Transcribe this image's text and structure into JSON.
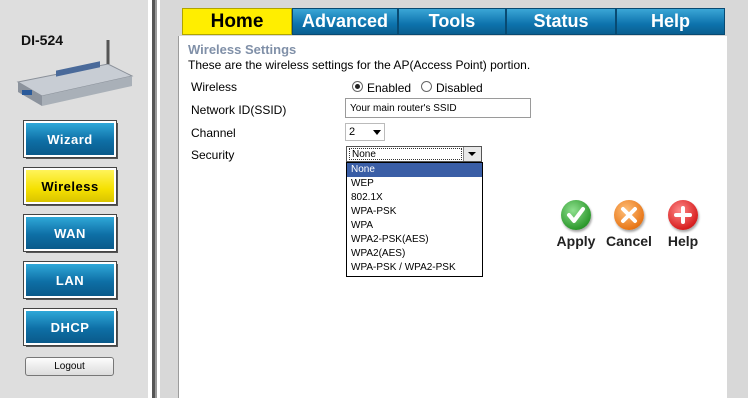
{
  "sidebar": {
    "model": "DI-524",
    "nav": [
      "Wizard",
      "Wireless",
      "WAN",
      "LAN",
      "DHCP"
    ],
    "active_nav": "Wireless",
    "logout_label": "Logout"
  },
  "tabs": [
    "Home",
    "Advanced",
    "Tools",
    "Status",
    "Help"
  ],
  "active_tab": "Home",
  "form": {
    "section_title": "Wireless Settings",
    "description": "These are the wireless settings for the AP(Access Point) portion.",
    "wireless_label": "Wireless",
    "enabled_label": "Enabled",
    "disabled_label": "Disabled",
    "wireless_value": "Enabled",
    "ssid_label": "Network ID(SSID)",
    "ssid_value": "Your main router's SSID",
    "channel_label": "Channel",
    "channel_value": "2",
    "security_label": "Security",
    "security_value": "None",
    "security_options": [
      "None",
      "WEP",
      "802.1X",
      "WPA-PSK",
      "WPA",
      "WPA2-PSK(AES)",
      "WPA2(AES)",
      "WPA-PSK / WPA2-PSK"
    ]
  },
  "actions": {
    "apply_label": "Apply",
    "cancel_label": "Cancel",
    "help_label": "Help"
  },
  "colors": {
    "tab_blue": "#0d73ad",
    "tab_active": "#ffee00",
    "nav_active": "#f5e000",
    "apply_green": "#3aa83a",
    "cancel_orange": "#e87a1a",
    "help_red": "#d82020",
    "dropdown_highlight": "#3a5ea6"
  }
}
